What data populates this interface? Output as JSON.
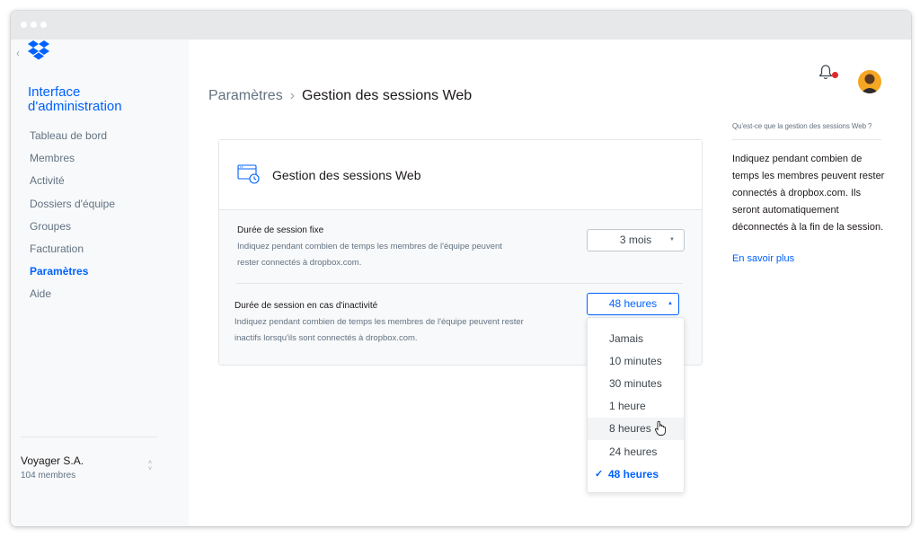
{
  "sidebar": {
    "back_icon": "chevron-left-icon",
    "logo_icon": "dropbox-logo-icon",
    "title": "Interface d'administration",
    "items": [
      {
        "label": "Tableau de bord",
        "active": false
      },
      {
        "label": "Membres",
        "active": false
      },
      {
        "label": "Activité",
        "active": false
      },
      {
        "label": "Dossiers d'équipe",
        "active": false
      },
      {
        "label": "Groupes",
        "active": false
      },
      {
        "label": "Facturation",
        "active": false
      },
      {
        "label": "Paramètres",
        "active": true
      },
      {
        "label": "Aide",
        "active": false
      }
    ],
    "team": {
      "name": "Voyager S.A.",
      "members": "104 membres"
    }
  },
  "header": {
    "breadcrumb_parent": "Paramètres",
    "breadcrumb_sep": "›",
    "breadcrumb_current": "Gestion des sessions Web",
    "notification_icon": "bell-icon",
    "has_unread": true
  },
  "card": {
    "icon": "browser-clock-icon",
    "title": "Gestion des sessions Web",
    "fixed": {
      "title": "Durée de session fixe",
      "desc": "Indiquez pendant combien de temps les membres de l'équipe peuvent rester connectés à dropbox.com.",
      "value": "3 mois"
    },
    "idle": {
      "title": "Durée de session en cas d'inactivité",
      "desc": "Indiquez pendant combien de temps les membres de l'équipe peuvent rester inactifs lorsqu'ils sont connectés à dropbox.com.",
      "value": "48 heures"
    }
  },
  "dropdown": {
    "options": [
      "Jamais",
      "10 minutes",
      "30 minutes",
      "1 heure",
      "8 heures",
      "24 heures",
      "48 heures"
    ],
    "hovered": "8 heures",
    "selected": "48 heures"
  },
  "help": {
    "question": "Qu'est-ce que la gestion des sessions Web ?",
    "text": "Indiquez pendant combien de temps les membres peuvent rester connectés à dropbox.com. Ils seront automatiquement déconnectés à la fin de la session.",
    "link": "En savoir plus"
  },
  "colors": {
    "accent": "#0061fe",
    "notification": "#e02828",
    "avatar": "#f5a623"
  }
}
